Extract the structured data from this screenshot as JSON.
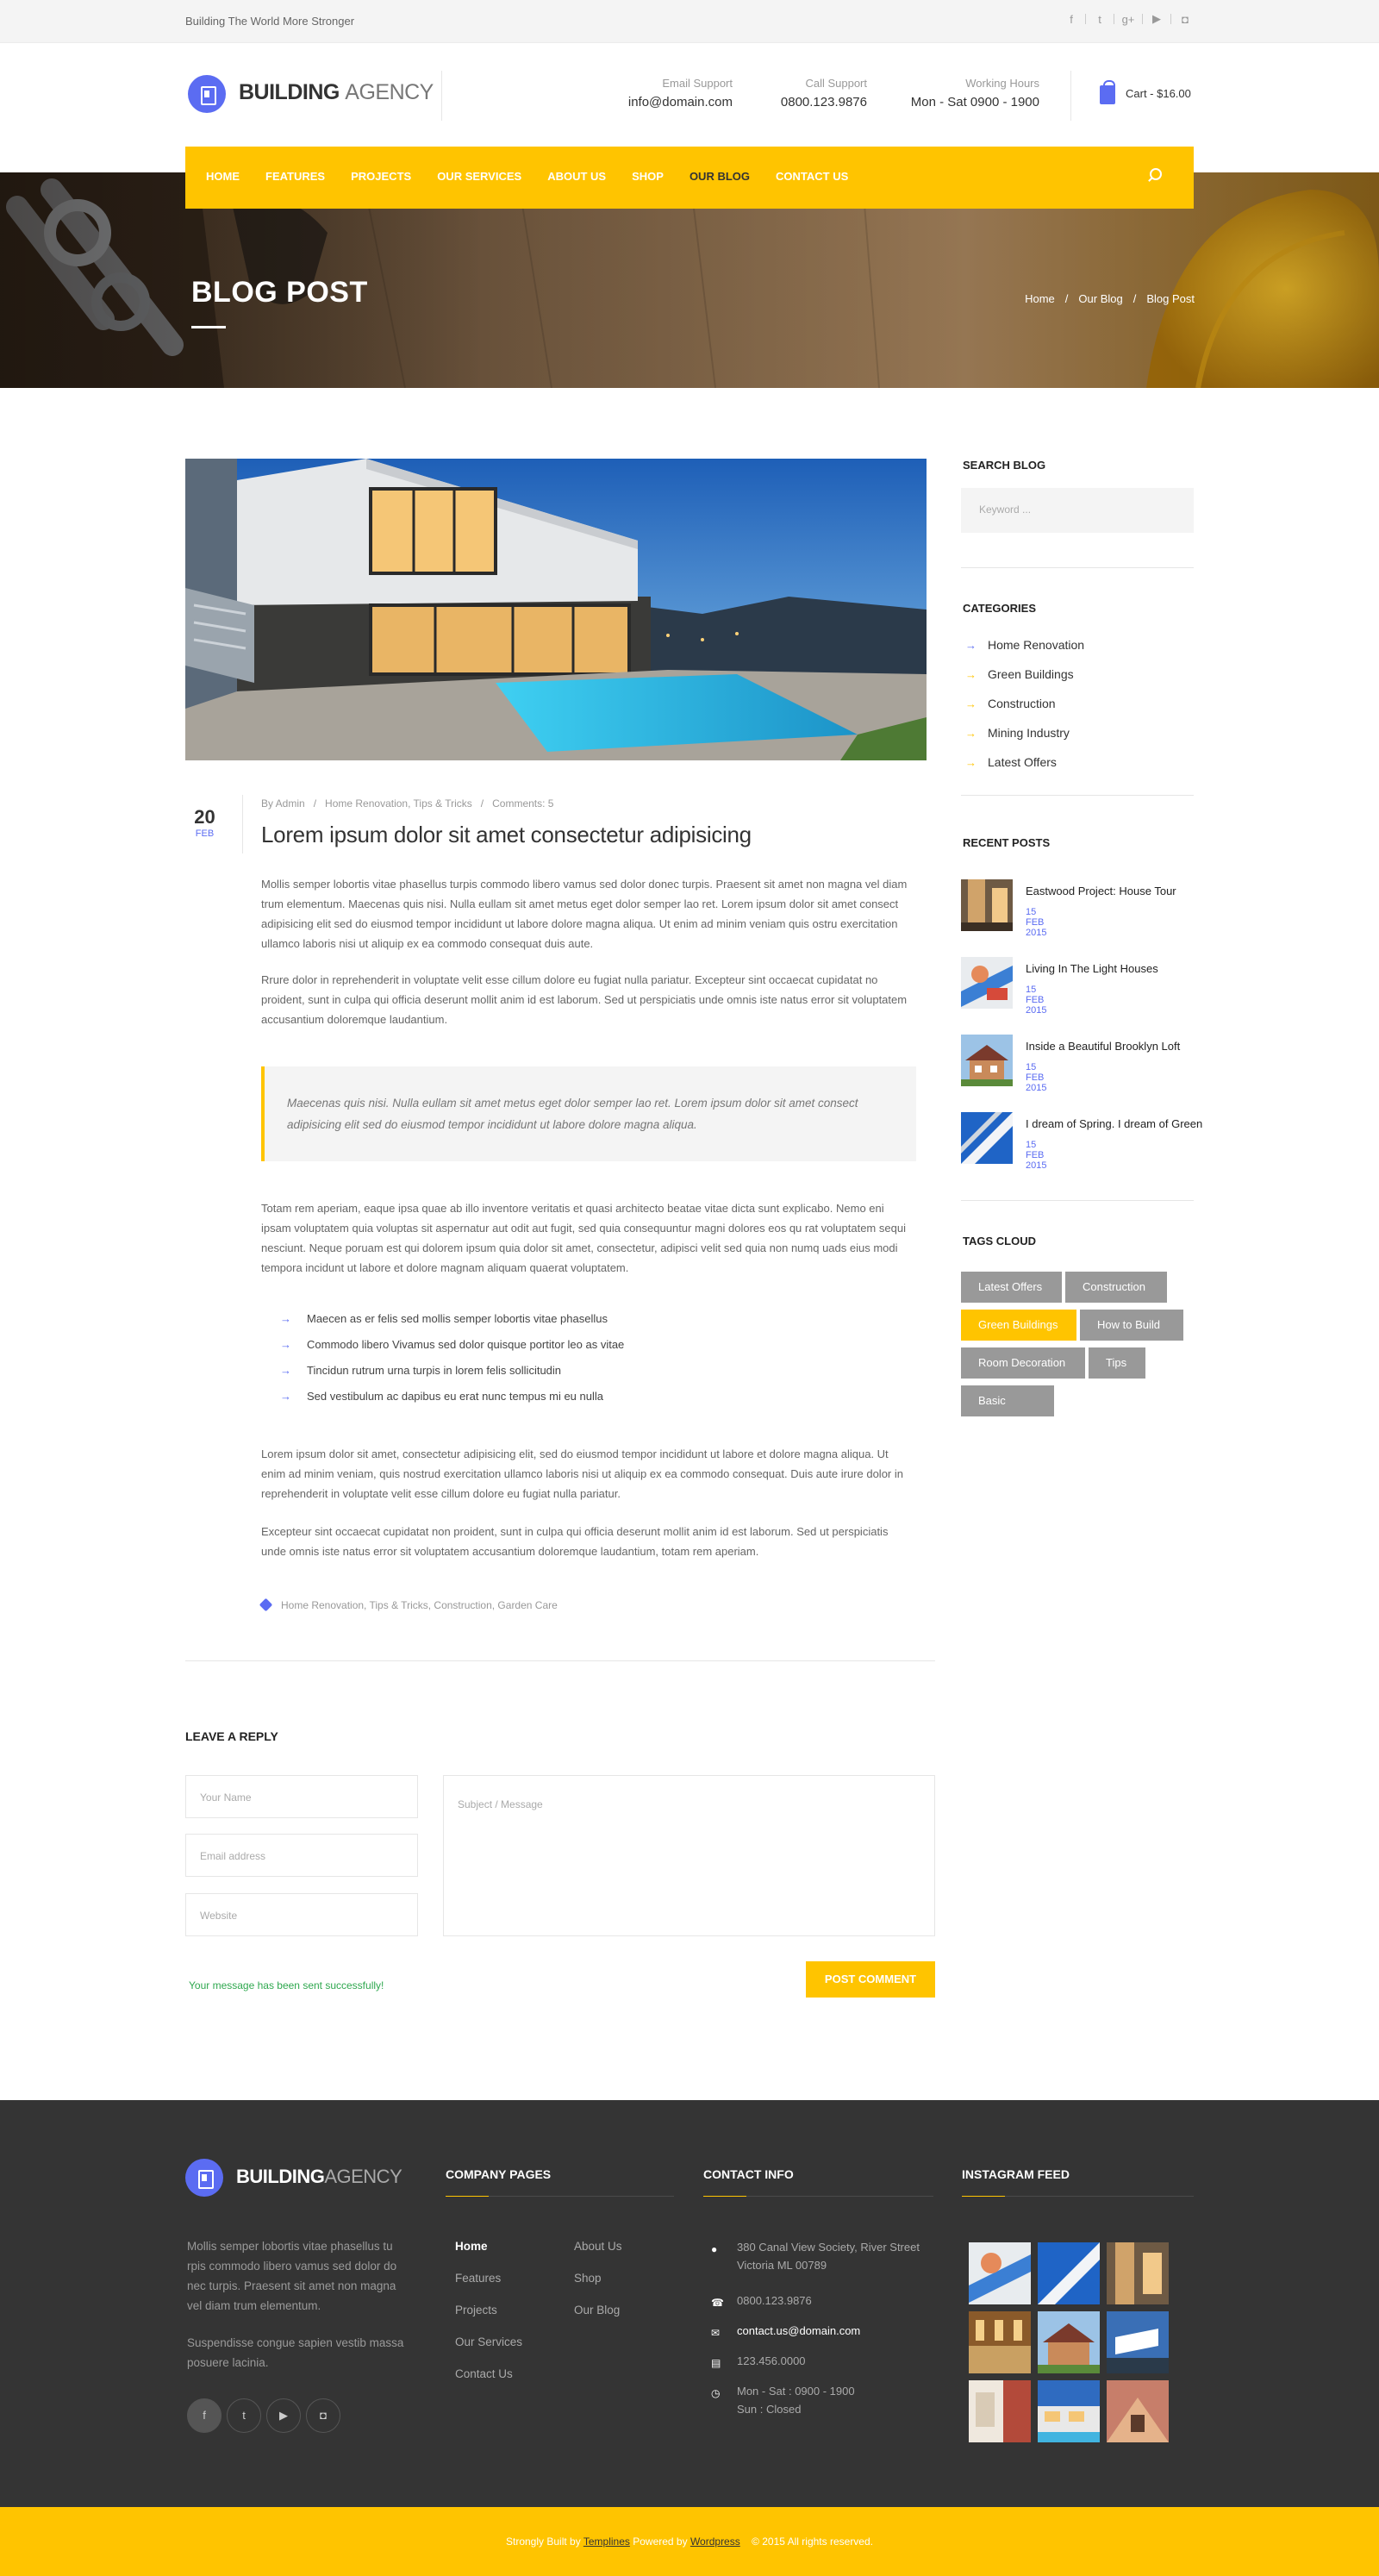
{
  "topbar": {
    "tagline": "Building The World More Stronger",
    "social_icons": [
      "facebook-icon",
      "twitter-icon",
      "google-plus-icon",
      "youtube-icon",
      "instagram-icon"
    ]
  },
  "header": {
    "logo_part1": "BUILDING",
    "logo_part2": "AGENCY",
    "email_label": "Email Support",
    "email_value": "info@domain.com",
    "call_label": "Call Support",
    "call_value": "0800.123.9876",
    "hours_label": "Working Hours",
    "hours_value": "Mon - Sat 0900 - 1900",
    "cart": "Cart - $16.00"
  },
  "nav": {
    "items": [
      "HOME",
      "FEATURES",
      "PROJECTS",
      "OUR SERVICES",
      "ABOUT US",
      "SHOP",
      "OUR BLOG",
      "CONTACT US"
    ],
    "active": "OUR BLOG"
  },
  "hero": {
    "title": "BLOG POST",
    "breadcrumb": [
      "Home",
      "Our Blog",
      "Blog Post"
    ],
    "sep": "/"
  },
  "post": {
    "day": "20",
    "month": "FEB",
    "author": "By Admin",
    "categories": "Home Renovation, Tips & Tricks",
    "comments": "Comments: 5",
    "title": "Lorem ipsum dolor sit amet consectetur adipisicing",
    "p1": "Mollis semper lobortis vitae phasellus turpis commodo libero vamus sed dolor donec turpis. Praesent sit amet non magna vel diam trum elementum. Maecenas quis nisi. Nulla eullam sit amet metus eget dolor semper lao ret. Lorem ipsum dolor sit amet consect adipisicing elit sed do eiusmod tempor incididunt ut labore dolore magna aliqua. Ut enim ad minim veniam quis ostru exercitation ullamco laboris nisi ut aliquip ex ea commodo consequat duis aute.",
    "p2": "Rrure dolor in reprehenderit in voluptate velit esse cillum dolore eu fugiat nulla pariatur. Excepteur sint occaecat cupidatat no proident, sunt in culpa qui officia deserunt mollit anim id est laborum. Sed ut perspiciatis unde omnis iste natus error sit voluptatem accusantium doloremque laudantium.",
    "quote": "Maecenas quis nisi. Nulla eullam sit amet metus eget dolor semper lao ret. Lorem ipsum dolor sit amet consect adipisicing elit sed do eiusmod tempor incididunt ut labore dolore magna aliqua.",
    "p3": "Totam rem aperiam, eaque ipsa quae ab illo inventore veritatis et quasi architecto beatae vitae dicta sunt explicabo. Nemo eni ipsam voluptatem quia voluptas sit aspernatur aut odit aut fugit, sed quia consequuntur magni dolores eos qu rat voluptatem sequi nesciunt. Neque poruam est qui dolorem ipsum quia dolor sit amet, consectetur, adipisci velit sed quia non numq uads eius modi tempora incidunt ut labore et dolore magnam aliquam quaerat voluptatem.",
    "list": [
      "Maecen as er felis sed mollis semper lobortis vitae phasellus",
      "Commodo libero Vivamus sed dolor quisque portitor leo as vitae",
      "Tincidun rutrum urna turpis in lorem felis sollicitudin",
      "Sed vestibulum ac dapibus eu erat nunc tempus mi eu nulla"
    ],
    "p4": "Lorem ipsum dolor sit amet, consectetur adipisicing elit, sed do eiusmod tempor incididunt ut labore et dolore magna aliqua. Ut enim ad minim veniam, quis nostrud exercitation ullamco laboris nisi ut aliquip ex ea commodo consequat. Duis aute irure dolor in reprehenderit in voluptate velit esse cillum dolore eu fugiat nulla pariatur.",
    "p5": "Excepteur sint occaecat cupidatat non proident, sunt in culpa qui officia deserunt mollit anim id est laborum. Sed ut perspiciatis unde omnis iste natus error sit voluptatem accusantium doloremque laudantium, totam rem aperiam.",
    "tags": "Home Renovation, Tips & Tricks, Construction, Garden Care"
  },
  "reply": {
    "title": "LEAVE A REPLY",
    "name_placeholder": "Your Name",
    "email_placeholder": "Email address",
    "website_placeholder": "Website",
    "message_placeholder": "Subject / Message",
    "success": "Your message has been sent successfully!",
    "submit": "POST COMMENT"
  },
  "sidebar": {
    "search_title": "SEARCH BLOG",
    "search_placeholder": "Keyword ...",
    "categories_title": "CATEGORIES",
    "categories": [
      "Home Renovation",
      "Green Buildings",
      "Construction",
      "Mining Industry",
      "Latest Offers"
    ],
    "recent_title": "RECENT POSTS",
    "recent": [
      {
        "title": "Eastwood Project: House Tour",
        "date": "15 FEB 2015"
      },
      {
        "title": "Living In The Light Houses",
        "date": "15 FEB 2015"
      },
      {
        "title": "Inside a Beautiful Brooklyn Loft",
        "date": "15 FEB 2015"
      },
      {
        "title": "I dream of Spring. I dream of Green",
        "date": "15 FEB 2015"
      }
    ],
    "tags_title": "TAGS CLOUD",
    "tags": [
      "Latest Offers",
      "Construction",
      "Green Buildings",
      "How to Build",
      "Room Decoration",
      "Tips",
      "Basic Tricks"
    ],
    "active_tag": "Green Buildings"
  },
  "footer": {
    "logo_part1": "BUILDING",
    "logo_part2": "AGENCY",
    "about1": "Mollis semper lobortis vitae phasellus tu rpis commodo libero vamus sed dolor do nec turpis. Praesent sit amet non magna vel diam trum elementum.",
    "about2": "Suspendisse congue sapien vestib massa posuere lacinia.",
    "social": [
      "facebook-icon",
      "twitter-icon",
      "youtube-icon",
      "instagram-icon"
    ],
    "pages_title": "COMPANY PAGES",
    "pages_col1": [
      "Home",
      "Features",
      "Projects",
      "Our Services",
      "Contact Us"
    ],
    "pages_col2": [
      "About Us",
      "Shop",
      "Our Blog"
    ],
    "contact_title": "CONTACT INFO",
    "address": "380 Canal View Society, River Street Victoria ML 00789",
    "phone": "0800.123.9876",
    "email": "contact.us@domain.com",
    "fax": "123.456.0000",
    "hours": "Mon - Sat : 0900 - 1900\nSun : Closed",
    "insta_title": "INSTAGRAM FEED"
  },
  "bottombar": {
    "pre": "Strongly Built by",
    "link1": "Templines",
    "mid": "Powered by",
    "link2": "Wordpress",
    "post": "© 2015 All rights reserved."
  },
  "colors": {
    "accent": "#ffc400",
    "brand": "#5b6cf2",
    "footer_bg": "#343434"
  }
}
